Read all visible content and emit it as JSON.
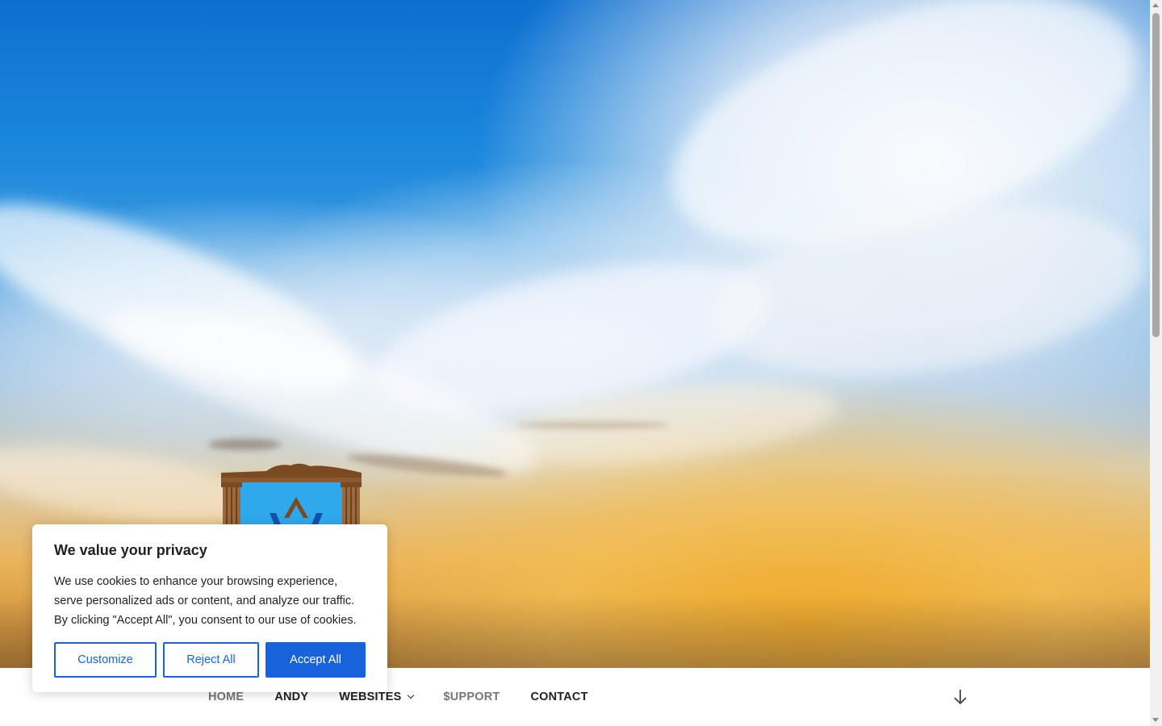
{
  "nav": {
    "items": [
      {
        "label": "HOME",
        "muted": true
      },
      {
        "label": "ANDY",
        "muted": false
      },
      {
        "label": "WEBSITES",
        "muted": false,
        "has_dropdown": true
      },
      {
        "label": "$UPPORT",
        "muted": true
      },
      {
        "label": "CONTACT",
        "muted": false
      }
    ]
  },
  "cookie": {
    "title": "We value your privacy",
    "text": "We use cookies to enhance your browsing experience, serve personalized ads or content, and analyze our traffic. By clicking \"Accept All\", you consent to our use of cookies.",
    "buttons": {
      "customize": "Customize",
      "reject": "Reject All",
      "accept": "Accept All"
    }
  },
  "icons": {
    "scroll_down": "arrow-down-icon",
    "dropdown": "chevron-down-icon"
  },
  "colors": {
    "accent": "#1863dc",
    "nav_text": "#222222",
    "nav_muted": "#767676"
  }
}
